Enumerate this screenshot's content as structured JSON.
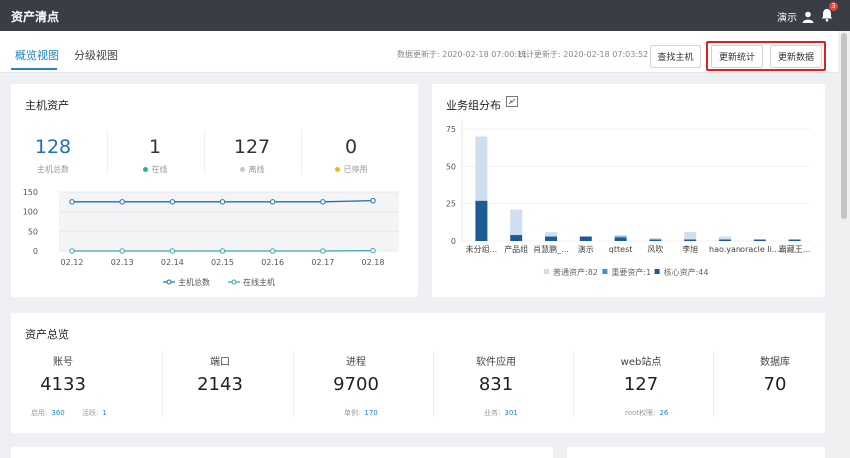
{
  "app": {
    "title": "资产清点",
    "user": "演示",
    "notifications": "3"
  },
  "tabs": [
    {
      "label": "概览视图"
    },
    {
      "label": "分级视图"
    }
  ],
  "update_info": {
    "data_updated": "数据更新于: 2020-02-18 07:00:11",
    "stats_updated": "统计更新于: 2020-02-18 07:03:52"
  },
  "buttons": {
    "find_host": "查找主机",
    "update_stats": "更新统计",
    "update_data": "更新数据"
  },
  "host_assets": {
    "title": "主机资产",
    "stats": [
      {
        "value": "128",
        "label": "主机总数"
      },
      {
        "value": "1",
        "label": "在线",
        "dot_color": "#2bb673"
      },
      {
        "value": "127",
        "label": "离线",
        "dot_color": "#c8c8c8"
      },
      {
        "value": "0",
        "label": "已停用",
        "dot_color": "#f5b800"
      }
    ]
  },
  "business_group": {
    "title": "业务组分布"
  },
  "chart_data": [
    {
      "type": "line",
      "x": [
        "02.12",
        "02.13",
        "02.14",
        "02.15",
        "02.16",
        "02.17",
        "02.18"
      ],
      "ylim": [
        0,
        150
      ],
      "yticks": [
        "150",
        "100",
        "50",
        "0"
      ],
      "series": [
        {
          "name": "主机总数",
          "color": "#1e6fb5",
          "values": [
            125,
            125,
            125,
            125,
            125,
            125,
            128
          ]
        },
        {
          "name": "在线主机",
          "color": "#36a3b8",
          "values": [
            0,
            0,
            0,
            0,
            0,
            0,
            1
          ]
        }
      ],
      "grid": true,
      "legend": "bottom"
    },
    {
      "type": "bar",
      "categories": [
        "未分组...",
        "产品组",
        "肖慧鹏_...",
        "演示",
        "qttest",
        "风吹",
        "李旭",
        "hao.yan",
        "oracle li...",
        "霸藏王..."
      ],
      "ylim": [
        0,
        75
      ],
      "yticks": [
        "75",
        "50",
        "25",
        "0"
      ],
      "series": [
        {
          "name": "普通资产:82",
          "color": "#cfdff0",
          "values": [
            43,
            17,
            3,
            0,
            1,
            1,
            5,
            2,
            0,
            0
          ]
        },
        {
          "name": "重要资产:1",
          "color": "#3b8fd4",
          "values": [
            0,
            0,
            0,
            0,
            1,
            0,
            0,
            0,
            0,
            0
          ]
        },
        {
          "name": "核心资产:44",
          "color": "#1e5b94",
          "values": [
            27,
            4,
            3,
            3,
            2,
            1,
            1,
            1,
            1,
            1
          ]
        }
      ],
      "legend": "bottom"
    }
  ],
  "asset_overview": {
    "title": "资产总览",
    "items": [
      {
        "label": "账号",
        "value": "4133"
      },
      {
        "label": "端口",
        "value": "2143"
      },
      {
        "label": "进程",
        "value": "9700"
      },
      {
        "label": "软件应用",
        "value": "831"
      },
      {
        "label": "web站点",
        "value": "127"
      },
      {
        "label": "数据库",
        "value": "70"
      }
    ],
    "subs": {
      "enabled_label": "启用:",
      "enabled_value": "360",
      "active_label": "活跃:",
      "active_value": "1",
      "single_label": "单例:",
      "single_value": "170",
      "business_label": "业务:",
      "business_value": "301",
      "root_label": "root权限:",
      "root_value": "26"
    }
  },
  "icons": {
    "user": "user-icon",
    "bell": "bell-icon",
    "expand": "expand-icon"
  }
}
